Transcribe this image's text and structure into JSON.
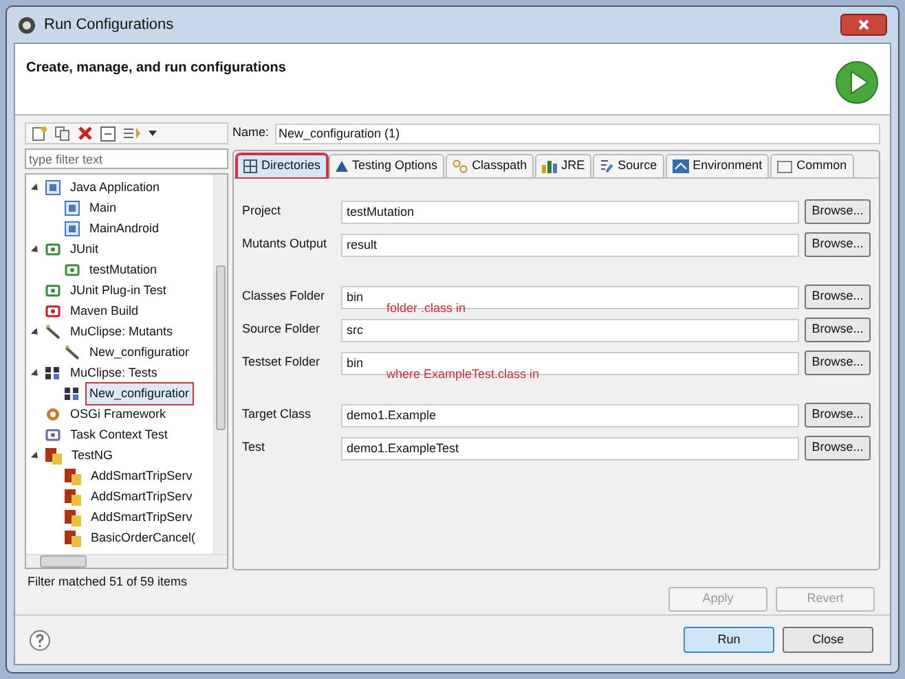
{
  "window": {
    "title": "Run Configurations"
  },
  "header": {
    "title": "Create, manage, and run configurations"
  },
  "filter": {
    "placeholder": "type filter text"
  },
  "tree": [
    {
      "label": "Java Application",
      "kind": "java",
      "expanded": true,
      "selected": false,
      "children": [
        {
          "label": "Main",
          "kind": "java",
          "selected": false
        },
        {
          "label": "MainAndroid",
          "kind": "java",
          "selected": false
        }
      ]
    },
    {
      "label": "JUnit",
      "kind": "junit",
      "expanded": true,
      "selected": false,
      "children": [
        {
          "label": "testMutation",
          "kind": "junit",
          "selected": false
        }
      ]
    },
    {
      "label": "JUnit Plug-in Test",
      "kind": "plugin",
      "selected": false
    },
    {
      "label": "Maven Build",
      "kind": "maven",
      "selected": false
    },
    {
      "label": "MuClipse: Mutants",
      "kind": "mutants",
      "expanded": true,
      "selected": false,
      "children": [
        {
          "label": "New_configuratior",
          "kind": "mutants",
          "selected": false
        }
      ]
    },
    {
      "label": "MuClipse: Tests",
      "kind": "tests",
      "expanded": true,
      "selected": false,
      "children": [
        {
          "label": "New_configuratior",
          "kind": "tests",
          "selected": true
        }
      ]
    },
    {
      "label": "OSGi Framework",
      "kind": "osgi",
      "selected": false
    },
    {
      "label": "Task Context Test",
      "kind": "task",
      "selected": false
    },
    {
      "label": "TestNG",
      "kind": "testng",
      "expanded": true,
      "selected": false,
      "children": [
        {
          "label": "AddSmartTripServ",
          "kind": "testng",
          "selected": false
        },
        {
          "label": "AddSmartTripServ",
          "kind": "testng",
          "selected": false
        },
        {
          "label": "AddSmartTripServ",
          "kind": "testng",
          "selected": false
        },
        {
          "label": "BasicOrderCancel(",
          "kind": "testng",
          "selected": false
        }
      ]
    }
  ],
  "filter_status": "Filter matched 51 of 59 items",
  "name": {
    "label": "Name:",
    "value": "New_configuration (1)"
  },
  "tabs": [
    {
      "label": "Directories",
      "kind": "grid",
      "selected": true
    },
    {
      "label": "Testing Options",
      "kind": "triangle",
      "selected": false
    },
    {
      "label": "Classpath",
      "kind": "classpath",
      "selected": false
    },
    {
      "label": "JRE",
      "kind": "jre",
      "selected": false
    },
    {
      "label": "Source",
      "kind": "source",
      "selected": false
    },
    {
      "label": "Environment",
      "kind": "env",
      "selected": false
    },
    {
      "label": "Common",
      "kind": "common",
      "selected": false
    }
  ],
  "field_groups": [
    [
      {
        "label": "Project",
        "value": "testMutation",
        "button": "Browse..."
      },
      {
        "label": "Mutants Output",
        "value": "result",
        "button": "Browse..."
      }
    ],
    [
      {
        "label": "Classes Folder",
        "value": "bin",
        "button": "Browse...",
        "note": "folder .class in"
      },
      {
        "label": "Source Folder",
        "value": "src",
        "button": "Browse..."
      },
      {
        "label": "Testset Folder",
        "value": "bin",
        "button": "Browse...",
        "note": "where ExampleTest.class in"
      }
    ],
    [
      {
        "label": "Target Class",
        "value": "demo1.Example",
        "button": "Browse..."
      },
      {
        "label": "Test",
        "value": "demo1.ExampleTest",
        "button": "Browse..."
      }
    ]
  ],
  "form_buttons": [
    {
      "label": "Apply",
      "disabled": true
    },
    {
      "label": "Revert",
      "disabled": true
    }
  ],
  "dialog_buttons": [
    {
      "label": "Run",
      "default": true
    },
    {
      "label": "Close",
      "default": false
    }
  ]
}
